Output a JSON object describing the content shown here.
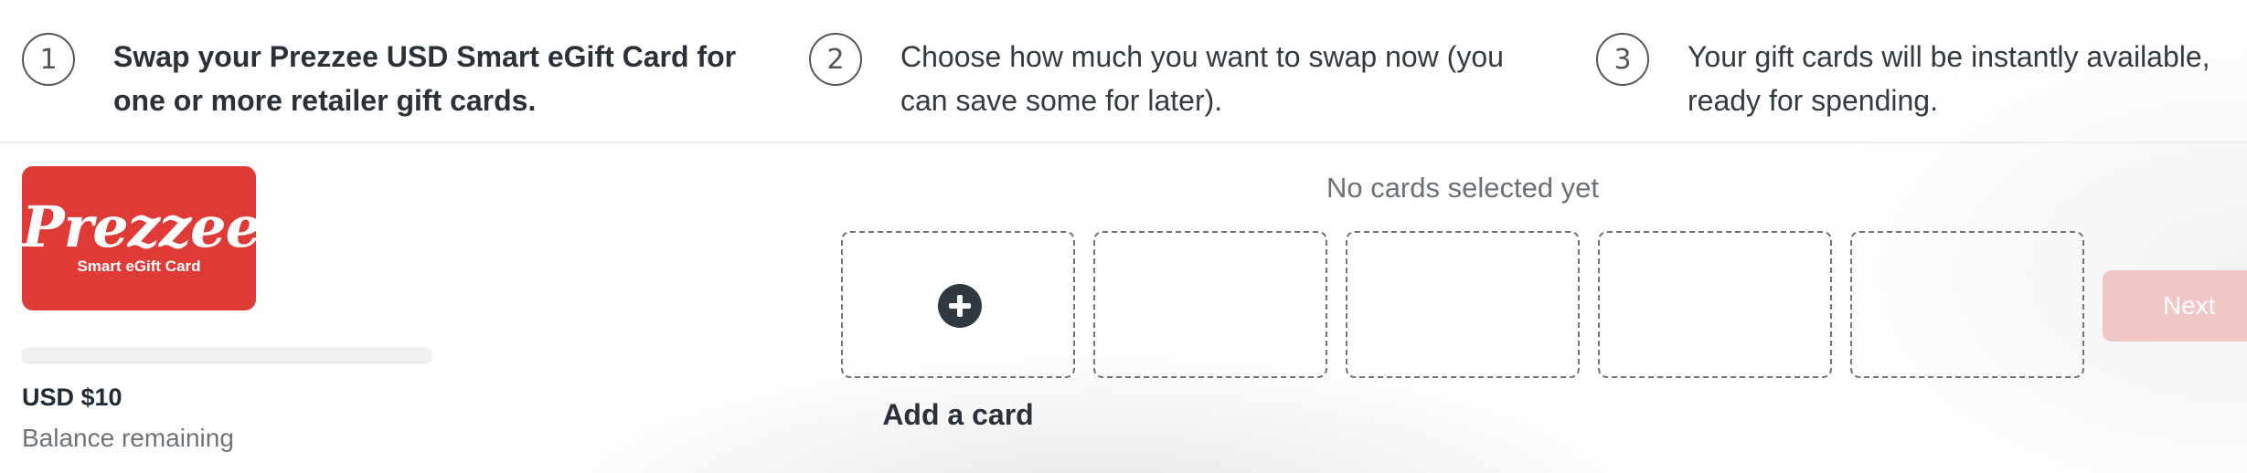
{
  "steps": [
    {
      "number": "1",
      "text_line1": "Swap your Prezzee USD Smart eGift Card for",
      "text_line2": "one or more retailer gift cards."
    },
    {
      "number": "2",
      "text_line1": "Choose how much you want to swap now (you",
      "text_line2": "can save some for later)."
    },
    {
      "number": "3",
      "text_line1": "Your gift cards will be instantly available,",
      "text_line2": "ready for spending."
    }
  ],
  "gift_card": {
    "brand": "Prezzee",
    "subtitle": "Smart eGift Card",
    "color": "#e03a36"
  },
  "balance": {
    "amount": "USD $10",
    "label": "Balance remaining"
  },
  "selection": {
    "empty_message": "No cards selected yet",
    "add_label": "Add a card",
    "slot_count": 5
  },
  "actions": {
    "next_label": "Next",
    "next_color": "#f1c7c6"
  },
  "icons": {
    "add": "plus-circle-icon"
  }
}
